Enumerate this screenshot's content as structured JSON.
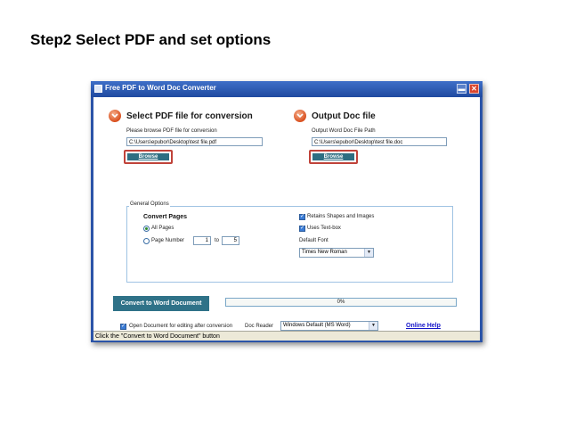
{
  "slide": {
    "title": "Step2 Select PDF and set options"
  },
  "window": {
    "title": "Free PDF to Word Doc Converter",
    "minimize_symbol": "▬",
    "close_symbol": "✕"
  },
  "pdf_section": {
    "title": "Select PDF file for conversion",
    "hint": "Please browse PDF file for conversion",
    "path": "C:\\Users\\epubor\\Desktop\\test file.pdf",
    "browse_label": "Browse"
  },
  "output_section": {
    "title": "Output Doc file",
    "hint": "Output Word Doc File Path",
    "path": "C:\\Users\\epubor\\Desktop\\test file.doc",
    "browse_label": "Browse"
  },
  "general_options": {
    "label": "General Options",
    "convert_pages_label": "Convert Pages",
    "all_pages_label": "All Pages",
    "page_number_label": "Page Number",
    "page_from": "1",
    "to_label": "to",
    "page_to": "5",
    "selected_range": "all",
    "retain_shapes_label": "Retains Shapes and Images",
    "retain_shapes_checked": true,
    "uses_textbox_label": "Uses Text-box",
    "uses_textbox_checked": true,
    "default_font_label": "Default Font",
    "default_font_value": "Times New Roman"
  },
  "actions": {
    "convert_label": "Convert to Word Document",
    "progress_text": "0%",
    "progress_value": 0,
    "open_after_label": "Open Document for editing after conversion",
    "open_after_checked": true,
    "doc_reader_label": "Doc Reader",
    "doc_reader_value": "Windows Default (MS Word)",
    "online_help_label": "Online Help"
  },
  "status": {
    "text": "Click the \"Convert to Word Document\" button"
  },
  "icons": {
    "checkmark": "✓",
    "dropdown": "▼"
  },
  "colors": {
    "titlebar": "#2b54a8",
    "accent_button": "#2f7288",
    "highlight_border": "#c0433a",
    "link": "#1515c9"
  }
}
